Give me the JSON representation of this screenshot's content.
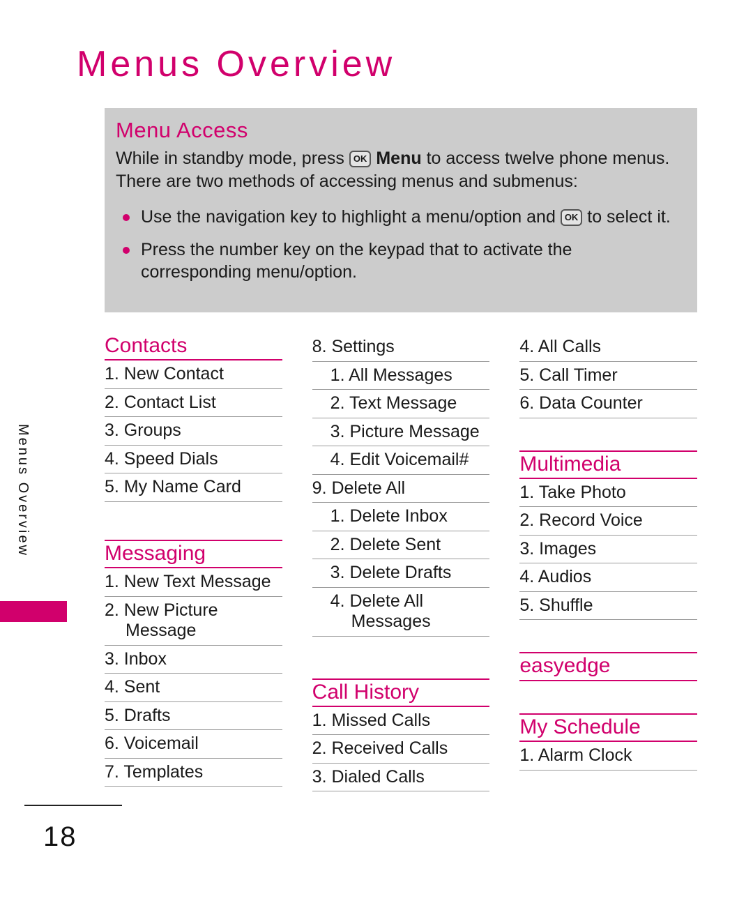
{
  "page": {
    "title": "Menus Overview",
    "side_tab_label": "Menus Overview",
    "number": "18",
    "accent_color": "#d1006c",
    "box_color": "#cccccc"
  },
  "info_box": {
    "heading": "Menu Access",
    "para_line1_a": "While in standby mode, press",
    "ok_key": "OK",
    "para_line1_b": "Menu",
    "para_line1_c": "to access twelve phone menus.",
    "para_line2": "There are two methods of accessing menus and submenus:",
    "bullets": [
      {
        "text_a": "Use the navigation key to highlight a menu/option and",
        "key": "OK",
        "text_b": "to select it."
      },
      {
        "text_a": "Press the number key on the keypad that to activate the corresponding menu/option.",
        "key": "",
        "text_b": ""
      }
    ]
  },
  "columns": [
    {
      "sections": [
        {
          "heading": "Contacts",
          "top_rule": false,
          "items": [
            {
              "label": "1. New Contact",
              "sub": false
            },
            {
              "label": "2. Contact List",
              "sub": false
            },
            {
              "label": "3. Groups",
              "sub": false
            },
            {
              "label": "4. Speed Dials",
              "sub": false
            },
            {
              "label": "5. My Name Card",
              "sub": false
            }
          ]
        },
        {
          "heading": "Messaging",
          "top_rule": true,
          "items": [
            {
              "label": "1. New Text Message",
              "sub": false
            },
            {
              "label": "2. New Picture",
              "wrap": "Message",
              "sub": false
            },
            {
              "label": "3. Inbox",
              "sub": false
            },
            {
              "label": "4. Sent",
              "sub": false
            },
            {
              "label": "5. Drafts",
              "sub": false
            },
            {
              "label": "6. Voicemail",
              "sub": false
            },
            {
              "label": "7.  Templates",
              "sub": false
            }
          ]
        }
      ]
    },
    {
      "sections": [
        {
          "heading": "",
          "top_rule": false,
          "items": [
            {
              "label": "8. Settings",
              "sub": false
            },
            {
              "label": "1. All Messages",
              "sub": true
            },
            {
              "label": "2. Text Message",
              "sub": true
            },
            {
              "label": "3. Picture Message",
              "sub": true
            },
            {
              "label": "4. Edit Voicemail#",
              "sub": true
            },
            {
              "label": "9. Delete All",
              "sub": false
            },
            {
              "label": "1. Delete Inbox",
              "sub": true
            },
            {
              "label": "2. Delete Sent",
              "sub": true
            },
            {
              "label": "3. Delete Drafts",
              "sub": true
            },
            {
              "label": "4. Delete All",
              "wrap": "Messages",
              "sub": true
            }
          ]
        },
        {
          "heading": "Call History",
          "top_rule": true,
          "items": [
            {
              "label": "1. Missed Calls",
              "sub": false
            },
            {
              "label": "2. Received Calls",
              "sub": false
            },
            {
              "label": "3. Dialed Calls",
              "sub": false
            }
          ]
        }
      ]
    },
    {
      "sections": [
        {
          "heading": "",
          "top_rule": false,
          "items": [
            {
              "label": "4. All Calls",
              "sub": false
            },
            {
              "label": "5. Call Timer",
              "sub": false
            },
            {
              "label": "6. Data Counter",
              "sub": false
            }
          ]
        },
        {
          "heading": "Multimedia",
          "top_rule": true,
          "items": [
            {
              "label": "1. Take Photo",
              "sub": false
            },
            {
              "label": "2. Record Voice",
              "sub": false
            },
            {
              "label": "3. Images",
              "sub": false
            },
            {
              "label": "4. Audios",
              "sub": false
            },
            {
              "label": "5. Shuffle",
              "sub": false
            }
          ]
        },
        {
          "heading": "easyedge",
          "top_rule": true,
          "items": []
        },
        {
          "heading": "My Schedule",
          "top_rule": true,
          "items": [
            {
              "label": "1. Alarm Clock",
              "sub": false
            }
          ]
        }
      ]
    }
  ]
}
